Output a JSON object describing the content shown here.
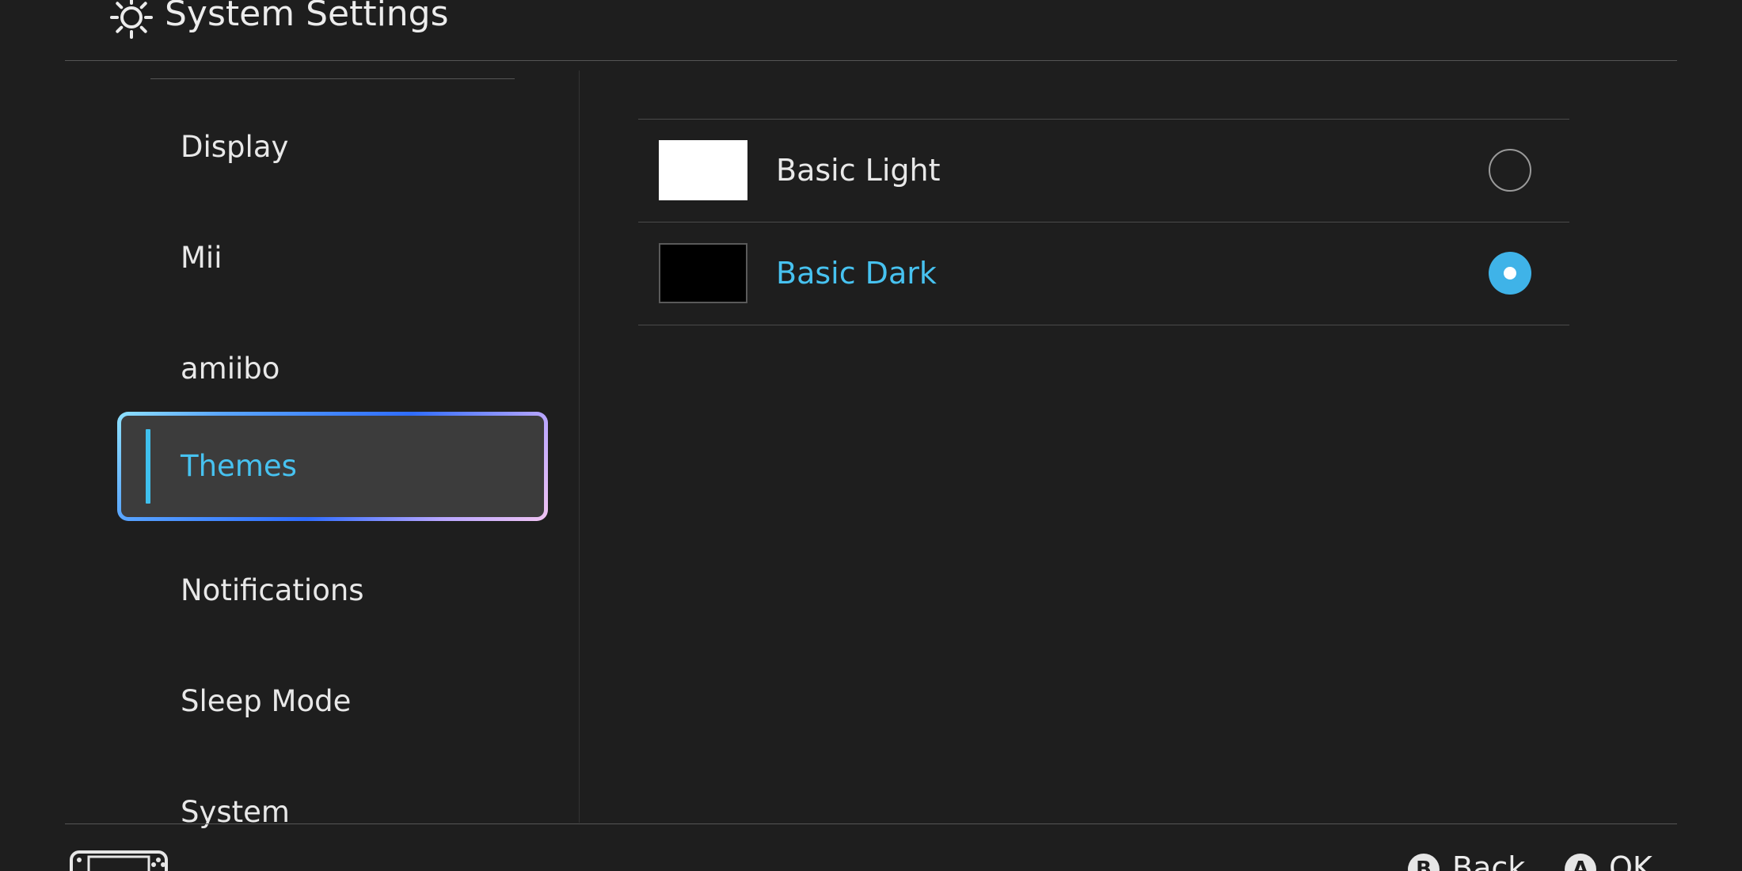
{
  "header": {
    "title": "System Settings",
    "icon": "gear-icon"
  },
  "sidebar": {
    "items": [
      {
        "label": "Display",
        "selected": false
      },
      {
        "label": "Mii",
        "selected": false
      },
      {
        "label": "amiibo",
        "selected": false
      },
      {
        "label": "Themes",
        "selected": true
      },
      {
        "label": "Notifications",
        "selected": false
      },
      {
        "label": "Sleep Mode",
        "selected": false
      },
      {
        "label": "System",
        "selected": false
      }
    ]
  },
  "themes": {
    "options": [
      {
        "label": "Basic Light",
        "swatch_color": "#ffffff",
        "selected": false
      },
      {
        "label": "Basic Dark",
        "swatch_color": "#000000",
        "selected": true
      }
    ]
  },
  "footer": {
    "back": {
      "glyph": "B",
      "label": "Back"
    },
    "ok": {
      "glyph": "A",
      "label": "OK"
    },
    "console_icon": "console-icon"
  },
  "colors": {
    "background": "#1e1e1e",
    "accent": "#47c2f0",
    "radio_selected": "#3fb3e8",
    "selection_fill": "#3c3c3c"
  }
}
